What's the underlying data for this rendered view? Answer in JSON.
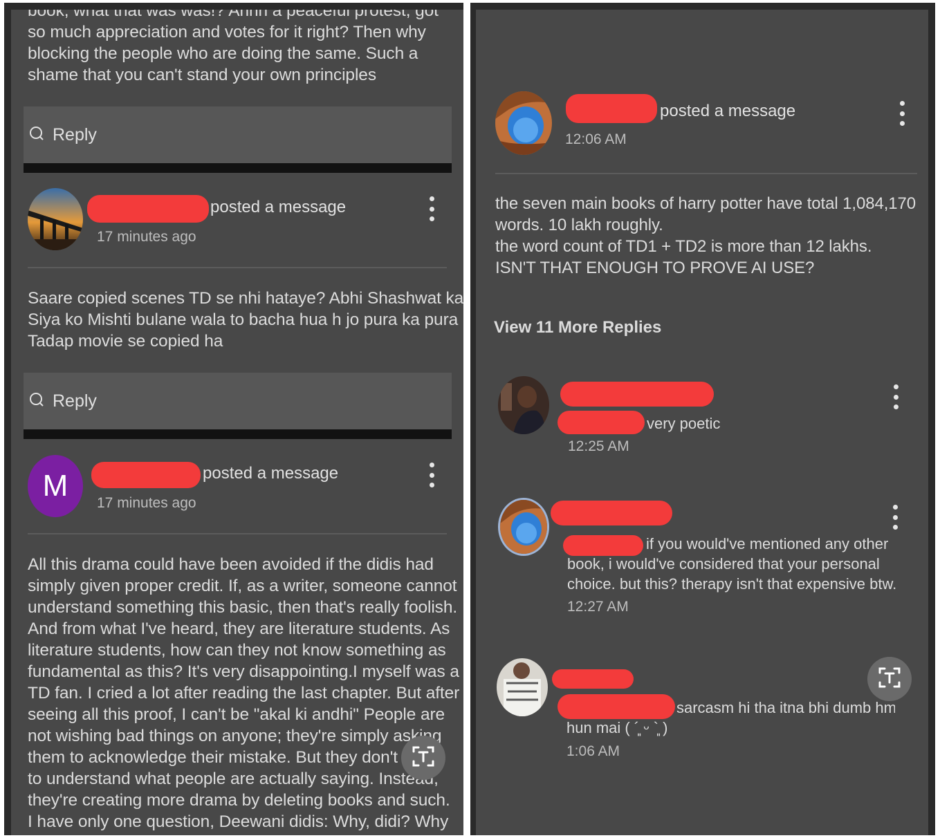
{
  "left": {
    "top_snippet": [
      "book, what that was was!? Ahhh a peaceful protest, got",
      "so much appreciation and votes for it right? Then why",
      "blocking the people who are doing the same. Such a",
      "shame that you can't stand your own principles"
    ],
    "reply_label": "Reply",
    "posts": [
      {
        "action": "posted a message",
        "time": "17 minutes ago",
        "body": [
          "Saare copied scenes TD se nhi hataye? Abhi Shashwat ka",
          "Siya ko Mishti bulane wala to bacha hua h jo pura ka pura",
          "Tadap movie se copied ha"
        ]
      },
      {
        "avatar_letter": "M",
        "avatar_color": "#7b1fa2",
        "action": "posted a message",
        "time": "17 minutes ago",
        "body": [
          "All this drama could have been avoided if the didis had",
          "simply given proper credit. If, as a writer, someone cannot",
          "understand something this basic, then that's really foolish.",
          "And from what I've heard, they are literature students. As",
          "literature students, how can they not know something as",
          "fundamental as this? It's very disappointing.I myself was a",
          "TD fan. I cried a lot after reading the last chapter. But after",
          "seeing all this proof, I can't be \"akal ki andhi\"  People are",
          "not wishing bad things on anyone; they're simply asking",
          "them to acknowledge their mistake. But they don't seem",
          "to understand what people are actually saying. Instead,",
          "they're creating more drama by deleting books and such.",
          "I have only one question, Deewani didis: Why, didi? Why"
        ]
      }
    ]
  },
  "right": {
    "post": {
      "action": "posted a message",
      "time": "12:06 AM",
      "body": [
        "the seven main books of harry potter have total 1,084,170",
        "words. 10 lakh roughly.",
        "the word count of TD1 + TD2 is more than 12 lakhs.",
        "ISN'T THAT ENOUGH TO PROVE AI USE?"
      ]
    },
    "view_more": "View 11 More Replies",
    "replies": [
      {
        "text": [
          "very poetic"
        ],
        "time": "12:25 AM"
      },
      {
        "text": [
          "if you would've mentioned any other",
          "book, i would've considered that your personal",
          "choice. but this? therapy isn't that expensive btw."
        ],
        "time": "12:27 AM"
      },
      {
        "text": [
          "sarcasm hi tha itna bhi dumb hm",
          "hun mai ( ´͈ ᵕ `͈ )"
        ],
        "time": "1:06 AM"
      }
    ]
  },
  "icons": {
    "reply": "comment-bubble-icon",
    "kebab": "more-vertical-icon",
    "fab": "text-scan-icon"
  },
  "colors": {
    "panel_bg": "#484848",
    "redaction": "#f33b3b",
    "reply_bar": "#575757"
  }
}
